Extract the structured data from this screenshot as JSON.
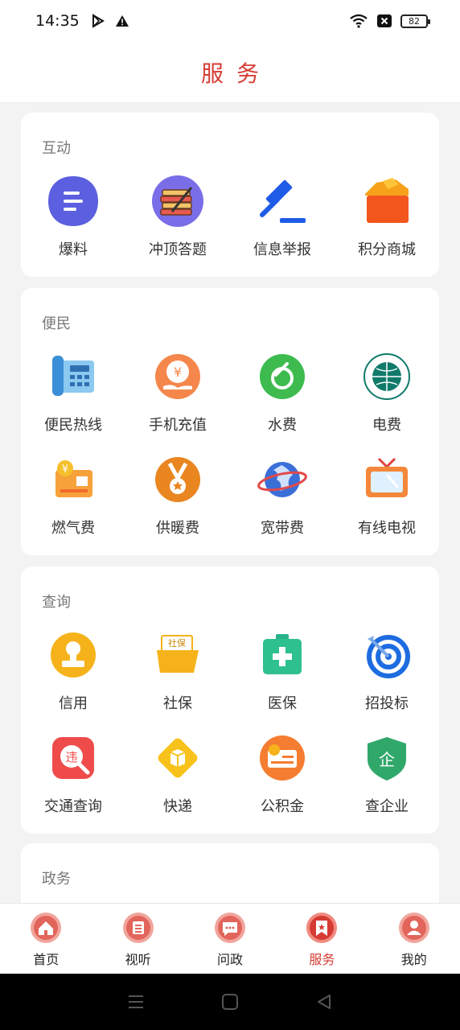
{
  "status": {
    "time": "14:35",
    "battery": "82"
  },
  "header": {
    "title": "服务"
  },
  "sections": {
    "interact": {
      "title": "互动",
      "items": [
        "爆料",
        "冲顶答题",
        "信息举报",
        "积分商城"
      ]
    },
    "convenience": {
      "title": "便民",
      "items": [
        "便民热线",
        "手机充值",
        "水费",
        "电费",
        "燃气费",
        "供暖费",
        "宽带费",
        "有线电视"
      ]
    },
    "query": {
      "title": "查询",
      "items": [
        "信用",
        "社保",
        "医保",
        "招投标",
        "交通查询",
        "快递",
        "公积金",
        "查企业"
      ]
    },
    "gov": {
      "title": "政务"
    }
  },
  "icon_text": {
    "shebao": "社保",
    "weizhang": "违",
    "qiye": "企"
  },
  "nav": {
    "items": [
      "首页",
      "视听",
      "问政",
      "服务",
      "我的"
    ],
    "active": "服务"
  },
  "colors": {
    "accent": "#d63b33"
  }
}
